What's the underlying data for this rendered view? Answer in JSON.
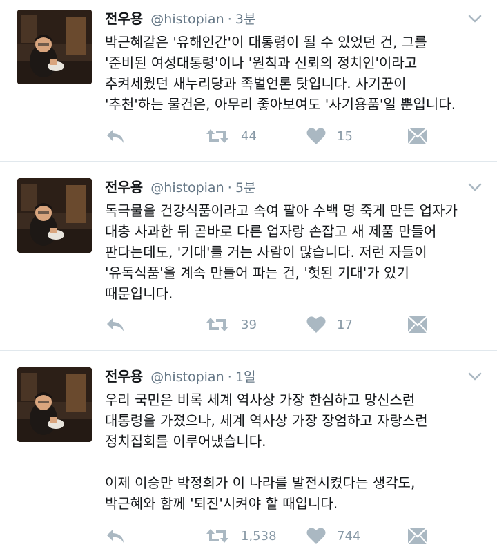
{
  "tweets": [
    {
      "name": "전우용",
      "handle": "@histopian",
      "separator": "·",
      "time": "3분",
      "lines": [
        "박근혜같은 '유해인간'이 대통령이 될 수 있었던 건, 그를",
        "'준비된 여성대통령'이나 '원칙과 신뢰의 정치인'이라고",
        "추켜세웠던 새누리당과 족벌언론 탓입니다. 사기꾼이",
        "'추천'하는 물건은, 아무리 좋아보여도 '사기용품'일 뿐입니다."
      ],
      "retweets": "44",
      "likes": "15"
    },
    {
      "name": "전우용",
      "handle": "@histopian",
      "separator": "·",
      "time": "5분",
      "lines": [
        "독극물을 건강식품이라고 속여 팔아 수백 명 죽게 만든 업자가",
        "대충 사과한 뒤 곧바로 다른 업자랑 손잡고 새 제품 만들어",
        "판다는데도, '기대'를 거는 사람이 많습니다. 저런 자들이",
        "'유독식품'을 계속 만들어 파는 건, '헛된 기대'가 있기",
        "때문입니다."
      ],
      "retweets": "39",
      "likes": "17"
    },
    {
      "name": "전우용",
      "handle": "@histopian",
      "separator": "·",
      "time": "1일",
      "lines": [
        "우리 국민은 비록 세계 역사상 가장 한심하고 망신스런",
        "대통령을 가졌으나, 세계 역사상 가장 장엄하고 자랑스런",
        "정치집회를 이루어냈습니다.",
        "",
        "이제 이승만 박정희가 이 나라를 발전시켰다는 생각도,",
        "박근혜와 함께 '퇴진'시켜야 할 때입니다."
      ],
      "retweets": "1,538",
      "likes": "744"
    }
  ],
  "icons": {
    "reply": "reply-icon",
    "retweet": "retweet-icon",
    "like": "heart-icon",
    "dm": "envelope-icon",
    "more": "chevron-down-icon"
  },
  "colors": {
    "icon": "#aab8c2",
    "secondary_text": "#657786",
    "count_text": "#8899a6",
    "divider": "#e1e8ed"
  }
}
